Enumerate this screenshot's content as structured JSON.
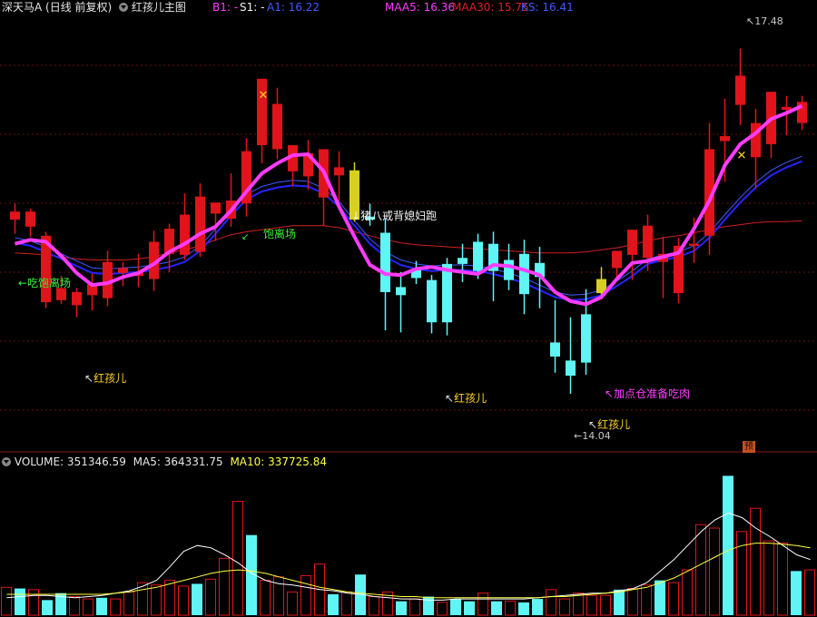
{
  "header": {
    "stock": "深天马A",
    "period": "(日线 前复权)",
    "indicator": "红孩儿主图",
    "b1": "B1: -",
    "s1": "S1: -",
    "a1": "A1: 16.22",
    "maa5": "MAA5: 16.36",
    "maa30": "MAA30: 15.75",
    "ks": "KS: 16.41"
  },
  "annotations": {
    "chi_bao_li_chang_1": "←吃饱离场",
    "chi_bao_li_chang_2": "饱离场",
    "zhu_ba_jie": "猪八戒背媳妇跑",
    "hong_hai_er": "红孩儿",
    "jia_dian_cang": "加点仓准备吃肉",
    "max_price": "17.48",
    "min_price": "14.04",
    "yu_badge": "预"
  },
  "volume_header": {
    "volume": "VOLUME: 351346.59",
    "ma5": "MA5: 364331.75",
    "ma10": "MA10: 337725.84"
  },
  "colors": {
    "up": "#e0141a",
    "down": "#5ff5f5",
    "doji": "#d8d020",
    "maa5": "#ff3cff",
    "ma_blue": "#2424ff",
    "ma_red": "#d02020",
    "a1": "#3a5cff",
    "vol_ma5": "#ffffff",
    "vol_ma10": "#ffff40"
  },
  "chart_data": {
    "type": "candlestick",
    "ylim": [
      13.5,
      17.8
    ],
    "candles": [
      {
        "o": 15.78,
        "h": 15.94,
        "l": 15.64,
        "c": 15.86,
        "t": "up"
      },
      {
        "o": 15.71,
        "h": 15.89,
        "l": 15.61,
        "c": 15.86,
        "t": "up"
      },
      {
        "o": 15.62,
        "h": 15.66,
        "l": 14.9,
        "c": 14.96,
        "t": "up"
      },
      {
        "o": 14.98,
        "h": 15.22,
        "l": 14.94,
        "c": 15.1,
        "t": "up"
      },
      {
        "o": 14.93,
        "h": 15.1,
        "l": 14.81,
        "c": 15.06,
        "t": "up"
      },
      {
        "o": 15.14,
        "h": 15.24,
        "l": 14.88,
        "c": 15.03,
        "t": "up"
      },
      {
        "o": 15.0,
        "h": 15.47,
        "l": 14.92,
        "c": 15.36,
        "t": "up"
      },
      {
        "o": 15.3,
        "h": 15.36,
        "l": 15.12,
        "c": 15.25,
        "t": "up"
      },
      {
        "o": 15.22,
        "h": 15.44,
        "l": 15.11,
        "c": 15.26,
        "t": "up"
      },
      {
        "o": 15.19,
        "h": 15.67,
        "l": 15.07,
        "c": 15.56,
        "t": "up"
      },
      {
        "o": 15.44,
        "h": 15.74,
        "l": 15.26,
        "c": 15.69,
        "t": "up"
      },
      {
        "o": 15.43,
        "h": 16.04,
        "l": 15.38,
        "c": 15.83,
        "t": "up"
      },
      {
        "o": 15.46,
        "h": 16.14,
        "l": 15.41,
        "c": 16.01,
        "t": "up"
      },
      {
        "o": 15.84,
        "h": 15.91,
        "l": 15.57,
        "c": 15.95,
        "t": "up"
      },
      {
        "o": 15.79,
        "h": 16.24,
        "l": 15.71,
        "c": 15.97,
        "t": "up"
      },
      {
        "o": 15.94,
        "h": 16.59,
        "l": 15.81,
        "c": 16.46,
        "t": "up"
      },
      {
        "o": 16.52,
        "h": 17.03,
        "l": 16.34,
        "c": 17.18,
        "t": "up"
      },
      {
        "o": 16.48,
        "h": 17.09,
        "l": 16.38,
        "c": 16.93,
        "t": "up"
      },
      {
        "o": 16.26,
        "h": 16.51,
        "l": 16.11,
        "c": 16.52,
        "t": "up"
      },
      {
        "o": 16.21,
        "h": 16.57,
        "l": 16.08,
        "c": 16.44,
        "t": "up"
      },
      {
        "o": 16.0,
        "h": 16.34,
        "l": 15.72,
        "c": 16.48,
        "t": "up"
      },
      {
        "o": 16.22,
        "h": 16.46,
        "l": 15.97,
        "c": 16.3,
        "t": "up"
      },
      {
        "o": 16.27,
        "h": 16.35,
        "l": 15.76,
        "c": 15.78,
        "t": "doji"
      },
      {
        "o": 15.78,
        "h": 15.94,
        "l": 15.72,
        "c": 15.81,
        "t": "down"
      },
      {
        "o": 15.65,
        "h": 15.8,
        "l": 14.68,
        "c": 15.06,
        "t": "down"
      },
      {
        "o": 15.03,
        "h": 15.26,
        "l": 14.66,
        "c": 15.11,
        "t": "down"
      },
      {
        "o": 15.29,
        "h": 15.37,
        "l": 15.14,
        "c": 15.2,
        "t": "down"
      },
      {
        "o": 14.76,
        "h": 15.23,
        "l": 14.65,
        "c": 15.18,
        "t": "down"
      },
      {
        "o": 14.76,
        "h": 15.4,
        "l": 14.63,
        "c": 15.34,
        "t": "down"
      },
      {
        "o": 15.4,
        "h": 15.54,
        "l": 15.16,
        "c": 15.34,
        "t": "down"
      },
      {
        "o": 15.27,
        "h": 15.64,
        "l": 15.19,
        "c": 15.56,
        "t": "down"
      },
      {
        "o": 15.54,
        "h": 15.66,
        "l": 14.97,
        "c": 15.27,
        "t": "down"
      },
      {
        "o": 15.38,
        "h": 15.54,
        "l": 15.08,
        "c": 15.18,
        "t": "down"
      },
      {
        "o": 15.04,
        "h": 15.58,
        "l": 14.84,
        "c": 15.44,
        "t": "down"
      },
      {
        "o": 15.35,
        "h": 15.51,
        "l": 14.9,
        "c": 15.21,
        "t": "down"
      },
      {
        "o": 14.42,
        "h": 14.98,
        "l": 14.26,
        "c": 14.56,
        "t": "down"
      },
      {
        "o": 14.23,
        "h": 14.81,
        "l": 14.05,
        "c": 14.38,
        "t": "down"
      },
      {
        "o": 14.36,
        "h": 15.09,
        "l": 14.24,
        "c": 14.84,
        "t": "down"
      },
      {
        "o": 15.05,
        "h": 15.31,
        "l": 14.99,
        "c": 15.19,
        "t": "doji"
      },
      {
        "o": 15.3,
        "h": 15.42,
        "l": 15.17,
        "c": 15.47,
        "t": "up"
      },
      {
        "o": 15.43,
        "h": 15.66,
        "l": 15.18,
        "c": 15.68,
        "t": "up"
      },
      {
        "o": 15.4,
        "h": 15.83,
        "l": 15.27,
        "c": 15.72,
        "t": "up"
      },
      {
        "o": 15.36,
        "h": 15.61,
        "l": 15.0,
        "c": 15.44,
        "t": "up"
      },
      {
        "o": 15.05,
        "h": 15.6,
        "l": 14.95,
        "c": 15.52,
        "t": "up"
      },
      {
        "o": 15.52,
        "h": 15.8,
        "l": 15.35,
        "c": 15.54,
        "t": "up"
      },
      {
        "o": 15.62,
        "h": 16.74,
        "l": 15.43,
        "c": 16.48,
        "t": "up"
      },
      {
        "o": 16.56,
        "h": 16.98,
        "l": 16.16,
        "c": 16.61,
        "t": "up"
      },
      {
        "o": 16.92,
        "h": 17.48,
        "l": 16.72,
        "c": 17.21,
        "t": "up"
      },
      {
        "o": 16.74,
        "h": 16.88,
        "l": 16.09,
        "c": 16.4,
        "t": "up"
      },
      {
        "o": 16.53,
        "h": 16.94,
        "l": 16.39,
        "c": 17.05,
        "t": "up"
      },
      {
        "o": 16.9,
        "h": 17.01,
        "l": 16.62,
        "c": 16.87,
        "t": "up"
      },
      {
        "o": 16.74,
        "h": 17.01,
        "l": 16.67,
        "c": 16.95,
        "t": "up"
      }
    ],
    "maa5_line": [
      15.54,
      15.58,
      15.56,
      15.42,
      15.25,
      15.13,
      15.15,
      15.21,
      15.25,
      15.34,
      15.46,
      15.54,
      15.64,
      15.71,
      15.87,
      16.06,
      16.24,
      16.34,
      16.42,
      16.43,
      16.26,
      15.91,
      15.61,
      15.33,
      15.24,
      15.23,
      15.29,
      15.31,
      15.28,
      15.26,
      15.24,
      15.33,
      15.32,
      15.28,
      15.23,
      15.06,
      14.97,
      14.94,
      15.01,
      15.19,
      15.35,
      15.37,
      15.41,
      15.45,
      15.69,
      15.97,
      16.32,
      16.53,
      16.64,
      16.78,
      16.84,
      16.91
    ],
    "ma_blue_line": [
      15.55,
      15.52,
      15.46,
      15.39,
      15.32,
      15.25,
      15.24,
      15.25,
      15.26,
      15.28,
      15.31,
      15.36,
      15.47,
      15.64,
      15.82,
      15.98,
      16.06,
      16.1,
      16.12,
      16.11,
      16.04,
      15.91,
      15.72,
      15.54,
      15.41,
      15.33,
      15.29,
      15.27,
      15.28,
      15.28,
      15.27,
      15.24,
      15.2,
      15.15,
      15.08,
      15.01,
      14.98,
      14.99,
      15.03,
      15.12,
      15.22,
      15.34,
      15.38,
      15.41,
      15.47,
      15.6,
      15.78,
      15.95,
      16.1,
      16.22,
      16.3,
      16.36
    ],
    "ma_red_line": [
      15.45,
      15.44,
      15.43,
      15.41,
      15.39,
      15.38,
      15.38,
      15.38,
      15.39,
      15.41,
      15.45,
      15.48,
      15.52,
      15.58,
      15.63,
      15.66,
      15.68,
      15.7,
      15.72,
      15.72,
      15.72,
      15.7,
      15.66,
      15.62,
      15.58,
      15.55,
      15.53,
      15.52,
      15.51,
      15.5,
      15.49,
      15.48,
      15.47,
      15.46,
      15.45,
      15.45,
      15.45,
      15.46,
      15.48,
      15.5,
      15.53,
      15.57,
      15.6,
      15.62,
      15.65,
      15.68,
      15.71,
      15.73,
      15.75,
      15.76,
      15.76,
      15.77
    ],
    "volume": [
      {
        "v": 0.24,
        "t": "up"
      },
      {
        "v": 0.23,
        "t": "down"
      },
      {
        "v": 0.22,
        "t": "up"
      },
      {
        "v": 0.13,
        "t": "down"
      },
      {
        "v": 0.19,
        "t": "down"
      },
      {
        "v": 0.16,
        "t": "up"
      },
      {
        "v": 0.14,
        "t": "up"
      },
      {
        "v": 0.15,
        "t": "down"
      },
      {
        "v": 0.14,
        "t": "up"
      },
      {
        "v": 0.2,
        "t": "up"
      },
      {
        "v": 0.28,
        "t": "up"
      },
      {
        "v": 0.26,
        "t": "up"
      },
      {
        "v": 0.3,
        "t": "up"
      },
      {
        "v": 0.25,
        "t": "up"
      },
      {
        "v": 0.27,
        "t": "down"
      },
      {
        "v": 0.31,
        "t": "up"
      },
      {
        "v": 0.49,
        "t": "up"
      },
      {
        "v": 0.98,
        "t": "up"
      },
      {
        "v": 0.69,
        "t": "down"
      },
      {
        "v": 0.3,
        "t": "up"
      },
      {
        "v": 0.33,
        "t": "up"
      },
      {
        "v": 0.2,
        "t": "up"
      },
      {
        "v": 0.34,
        "t": "up"
      },
      {
        "v": 0.44,
        "t": "up"
      },
      {
        "v": 0.18,
        "t": "down"
      },
      {
        "v": 0.2,
        "t": "up"
      },
      {
        "v": 0.35,
        "t": "down"
      },
      {
        "v": 0.16,
        "t": "up"
      },
      {
        "v": 0.2,
        "t": "up"
      },
      {
        "v": 0.12,
        "t": "down"
      },
      {
        "v": 0.14,
        "t": "up"
      },
      {
        "v": 0.16,
        "t": "down"
      },
      {
        "v": 0.11,
        "t": "up"
      },
      {
        "v": 0.14,
        "t": "down"
      },
      {
        "v": 0.12,
        "t": "down"
      },
      {
        "v": 0.19,
        "t": "up"
      },
      {
        "v": 0.12,
        "t": "down"
      },
      {
        "v": 0.12,
        "t": "up"
      },
      {
        "v": 0.11,
        "t": "down"
      },
      {
        "v": 0.14,
        "t": "down"
      },
      {
        "v": 0.22,
        "t": "up"
      },
      {
        "v": 0.14,
        "t": "up"
      },
      {
        "v": 0.19,
        "t": "up"
      },
      {
        "v": 0.17,
        "t": "up"
      },
      {
        "v": 0.17,
        "t": "up"
      },
      {
        "v": 0.22,
        "t": "down"
      },
      {
        "v": 0.23,
        "t": "up"
      },
      {
        "v": 0.26,
        "t": "up"
      },
      {
        "v": 0.3,
        "t": "down"
      },
      {
        "v": 0.28,
        "t": "up"
      },
      {
        "v": 0.39,
        "t": "up"
      },
      {
        "v": 0.78,
        "t": "up"
      },
      {
        "v": 0.75,
        "t": "up"
      },
      {
        "v": 1.2,
        "t": "down"
      },
      {
        "v": 0.72,
        "t": "up"
      },
      {
        "v": 0.92,
        "t": "up"
      },
      {
        "v": 0.64,
        "t": "up"
      },
      {
        "v": 0.62,
        "t": "up"
      },
      {
        "v": 0.38,
        "t": "down"
      },
      {
        "v": 0.39,
        "t": "up"
      }
    ],
    "vol_ma5": [
      0.15,
      0.16,
      0.17,
      0.17,
      0.16,
      0.15,
      0.16,
      0.17,
      0.19,
      0.21,
      0.25,
      0.3,
      0.42,
      0.55,
      0.6,
      0.58,
      0.52,
      0.45,
      0.36,
      0.3,
      0.27,
      0.26,
      0.24,
      0.22,
      0.21,
      0.19,
      0.18,
      0.16,
      0.15,
      0.14,
      0.14,
      0.13,
      0.13,
      0.14,
      0.14,
      0.14,
      0.14,
      0.14,
      0.14,
      0.15,
      0.16,
      0.17,
      0.18,
      0.19,
      0.19,
      0.21,
      0.23,
      0.28,
      0.38,
      0.48,
      0.6,
      0.72,
      0.82,
      0.88,
      0.84,
      0.75,
      0.68,
      0.6,
      0.52,
      0.48
    ],
    "vol_ma10": [
      0.18,
      0.18,
      0.18,
      0.18,
      0.18,
      0.18,
      0.18,
      0.18,
      0.19,
      0.2,
      0.22,
      0.24,
      0.27,
      0.3,
      0.33,
      0.36,
      0.38,
      0.39,
      0.38,
      0.36,
      0.33,
      0.3,
      0.27,
      0.24,
      0.22,
      0.2,
      0.19,
      0.18,
      0.17,
      0.16,
      0.16,
      0.15,
      0.15,
      0.15,
      0.15,
      0.15,
      0.15,
      0.15,
      0.15,
      0.15,
      0.16,
      0.16,
      0.17,
      0.18,
      0.19,
      0.2,
      0.22,
      0.24,
      0.28,
      0.32,
      0.38,
      0.44,
      0.5,
      0.56,
      0.6,
      0.62,
      0.62,
      0.61,
      0.6,
      0.58
    ]
  }
}
